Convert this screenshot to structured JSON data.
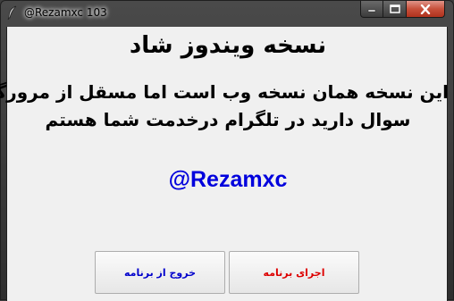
{
  "window": {
    "title": "@Rezamxc 103",
    "icon": "feather-icon",
    "controls": {
      "minimize_icon": "minimize-icon",
      "maximize_icon": "maximize-icon",
      "close_icon": "close-icon"
    }
  },
  "content": {
    "heading": "نسخه ویندوز شاد",
    "body_lines": [
      "این نسخه همان نسخه وب است اما مسقل از مرورگر",
      "سوال دارید در تلگرام درخدمت شما هستم"
    ],
    "handle": "@Rezamxc",
    "handle_color": "#0000dd"
  },
  "buttons": {
    "exit_label": "خروج از برنامه",
    "exit_color": "#0000cc",
    "run_label": "اجرای برنامه",
    "run_color": "#dd0000"
  }
}
